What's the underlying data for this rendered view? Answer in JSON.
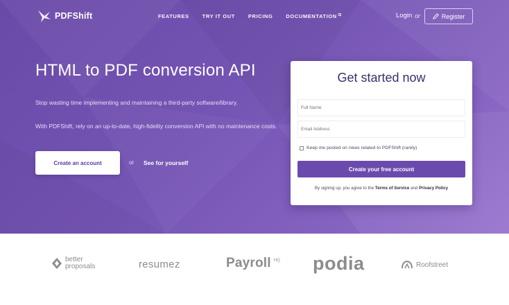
{
  "nav": {
    "logo_text": "PDFShift",
    "items": [
      {
        "label": "FEATURES"
      },
      {
        "label": "TRY IT OUT"
      },
      {
        "label": "PRICING"
      },
      {
        "label": "DOCUMENTATION"
      }
    ],
    "login": "Login",
    "or": "or",
    "register": "Register"
  },
  "hero": {
    "headline": "HTML to PDF conversion API",
    "sub1": "Stop wasting time implementing and maintaining a third-party software/library.",
    "sub2": "With PDFShift, rely on an up-to-date, high-fidelity conversion API with no maintenance costs.",
    "cta_label": "Create an account",
    "or": "or",
    "see_label": "See for yourself"
  },
  "signup": {
    "title": "Get started now",
    "fullname_placeholder": "Full Name",
    "email_placeholder": "Email Address",
    "checkbox_label": "Keep me posted on news related to PDFShift (rarely)",
    "submit_label": "Create your free account",
    "terms_prefix": "By signing up, you agree to the",
    "terms_link": "Terms of Service",
    "terms_and": "and",
    "privacy_link": "Privacy Policy"
  },
  "brands": {
    "better_line1": "better",
    "better_line2": "proposals",
    "resumez": "resumez",
    "payroll": "Payroll",
    "payroll_hq": "HQ",
    "podia": "podia",
    "roofstreet": "Roofstreet"
  },
  "colors": {
    "hero_start": "#6a4aa8",
    "hero_end": "#9873cf",
    "accent": "#6a4bad",
    "title": "#3d2d6b"
  }
}
